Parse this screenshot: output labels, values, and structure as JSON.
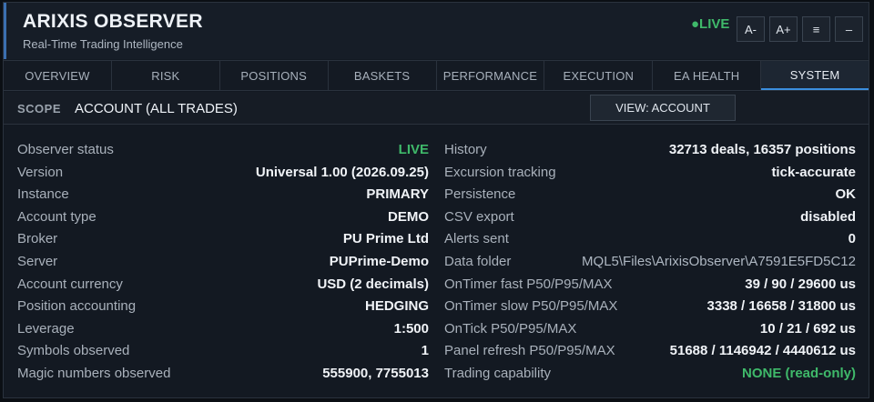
{
  "header": {
    "title": "ARIXIS OBSERVER",
    "subtitle": "Real-Time Trading Intelligence",
    "live_indicator": "●LIVE",
    "buttons": {
      "font_decrease": "A-",
      "font_increase": "A+",
      "menu_icon": "≡",
      "minimize_icon": "–"
    }
  },
  "tabs": [
    {
      "label": "OVERVIEW"
    },
    {
      "label": "RISK"
    },
    {
      "label": "POSITIONS"
    },
    {
      "label": "BASKETS"
    },
    {
      "label": "PERFORMANCE"
    },
    {
      "label": "EXECUTION"
    },
    {
      "label": "EA HEALTH"
    },
    {
      "label": "SYSTEM",
      "active": true
    }
  ],
  "scope": {
    "label": "SCOPE",
    "value": "ACCOUNT (ALL TRADES)",
    "view_button": "VIEW: ACCOUNT"
  },
  "left_rows": [
    {
      "label": "Observer status",
      "value": "LIVE"
    },
    {
      "label": "Version",
      "value": "Universal 1.00 (2026.09.25)"
    },
    {
      "label": "Instance",
      "value": "PRIMARY"
    },
    {
      "label": "Account type",
      "value": "DEMO"
    },
    {
      "label": "Broker",
      "value": "PU Prime Ltd"
    },
    {
      "label": "Server",
      "value": "PUPrime-Demo"
    },
    {
      "label": "Account currency",
      "value": "USD (2 decimals)"
    },
    {
      "label": "Position accounting",
      "value": "HEDGING"
    },
    {
      "label": "Leverage",
      "value": "1:500"
    },
    {
      "label": "Symbols observed",
      "value": "1"
    },
    {
      "label": "Magic numbers observed",
      "value": "555900, 7755013"
    }
  ],
  "right_rows": [
    {
      "label": "History",
      "value": "32713 deals, 16357 positions"
    },
    {
      "label": "Excursion tracking",
      "value": "tick-accurate"
    },
    {
      "label": "Persistence",
      "value": "OK"
    },
    {
      "label": "CSV export",
      "value": "disabled"
    },
    {
      "label": "Alerts sent",
      "value": "0"
    },
    {
      "label": "Data folder",
      "value": "MQL5\\Files\\ArixisObserver\\A7591E5FD5C12"
    },
    {
      "label": "OnTimer fast P50/P95/MAX",
      "value": "39 / 90 / 29600 us"
    },
    {
      "label": "OnTimer slow P50/P95/MAX",
      "value": "3338 / 16658 / 31800 us"
    },
    {
      "label": "OnTick P50/P95/MAX",
      "value": "10 / 21 / 692 us"
    },
    {
      "label": "Panel refresh P50/P95/MAX",
      "value": "51688 / 1146942 / 4440612 us"
    },
    {
      "label": "Trading capability",
      "value": "NONE (read-only)"
    }
  ],
  "colors": {
    "accent": "#3b8ede",
    "live_green": "#3fb96a",
    "background": "#131922"
  }
}
